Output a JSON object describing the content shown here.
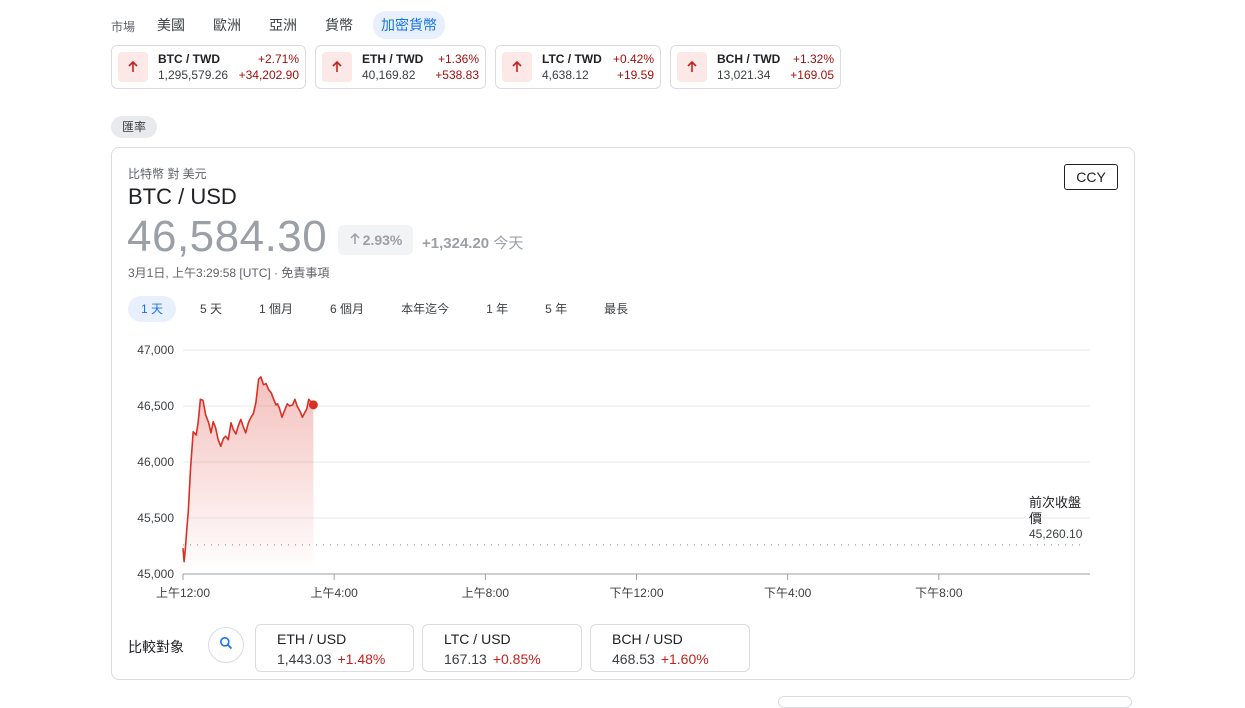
{
  "markets": {
    "label": "市場",
    "tabs": [
      {
        "label": "美國",
        "active": false
      },
      {
        "label": "歐洲",
        "active": false
      },
      {
        "label": "亞洲",
        "active": false
      },
      {
        "label": "貨幣",
        "active": false
      },
      {
        "label": "加密貨幣",
        "active": true
      }
    ]
  },
  "tickers": [
    {
      "symbol": "BTC / TWD",
      "price": "1,295,579.26",
      "pct": "+2.71%",
      "change": "+34,202.90"
    },
    {
      "symbol": "ETH / TWD",
      "price": "40,169.82",
      "pct": "+1.36%",
      "change": "+538.83"
    },
    {
      "symbol": "LTC / TWD",
      "price": "4,638.12",
      "pct": "+0.42%",
      "change": "+19.59"
    },
    {
      "symbol": "BCH / TWD",
      "price": "13,021.34",
      "pct": "+1.32%",
      "change": "+169.05"
    }
  ],
  "chip": "匯率",
  "quote": {
    "subtitle": "比特幣 對 美元",
    "pair": "BTC / USD",
    "ccy_button": "CCY",
    "price": "46,584.30",
    "pct": "2.93%",
    "change": "+1,324.20",
    "change_suffix": "今天",
    "timestamp": "3月1日, 上午3:29:58 [UTC] · 免責事項"
  },
  "ranges": [
    {
      "label": "1 天",
      "active": true
    },
    {
      "label": "5 天",
      "active": false
    },
    {
      "label": "1 個月",
      "active": false
    },
    {
      "label": "6 個月",
      "active": false
    },
    {
      "label": "本年迄今",
      "active": false
    },
    {
      "label": "1 年",
      "active": false
    },
    {
      "label": "5 年",
      "active": false
    },
    {
      "label": "最長",
      "active": false
    }
  ],
  "chart_data": {
    "type": "area",
    "title": "",
    "xlabel": "",
    "ylabel": "",
    "ylim": [
      45000,
      47000
    ],
    "y_ticks": [
      47000,
      46500,
      46000,
      45500,
      45000
    ],
    "y_tick_labels": [
      "47,000",
      "46,500",
      "46,000",
      "45,500",
      "45,000"
    ],
    "x_range_hours": [
      0,
      24
    ],
    "x_ticks": [
      0,
      4,
      8,
      12,
      16,
      20
    ],
    "x_tick_labels": [
      "上午12:00",
      "上午4:00",
      "上午8:00",
      "下午12:00",
      "下午4:00",
      "下午8:00"
    ],
    "series": [
      {
        "x": [
          0.0,
          0.03,
          0.06,
          0.1,
          0.14,
          0.2,
          0.27,
          0.3,
          0.35,
          0.4,
          0.46,
          0.53,
          0.6,
          0.68,
          0.74,
          0.8,
          0.86,
          0.93,
          1.0,
          1.07,
          1.13,
          1.2,
          1.27,
          1.33,
          1.4,
          1.46,
          1.53,
          1.6,
          1.66,
          1.73,
          1.8,
          1.86,
          1.93,
          2.0,
          2.06,
          2.13,
          2.2,
          2.26,
          2.33,
          2.4,
          2.46,
          2.5,
          2.55,
          2.62,
          2.7,
          2.76,
          2.82,
          2.9,
          2.96,
          3.02,
          3.1,
          3.16,
          3.22,
          3.27,
          3.33,
          3.4,
          3.45
        ],
        "values": [
          45230,
          45110,
          45220,
          45400,
          45560,
          45950,
          46270,
          46260,
          46240,
          46350,
          46560,
          46550,
          46420,
          46350,
          46260,
          46360,
          46310,
          46200,
          46140,
          46210,
          46230,
          46200,
          46350,
          46290,
          46250,
          46320,
          46380,
          46310,
          46260,
          46350,
          46400,
          46430,
          46530,
          46740,
          46760,
          46690,
          46700,
          46650,
          46620,
          46560,
          46510,
          46520,
          46480,
          46400,
          46470,
          46520,
          46500,
          46510,
          46560,
          46500,
          46450,
          46400,
          46440,
          46470,
          46560,
          46530,
          46520
        ]
      }
    ],
    "last_point": {
      "x": 3.45,
      "y": 46510
    },
    "reference_line": {
      "value": 45260.1,
      "label": "前次收盤價",
      "value_label": "45,260.10"
    },
    "grid": true
  },
  "compare": {
    "label": "比較對象",
    "items": [
      {
        "symbol": "ETH / USD",
        "price": "1,443.03",
        "pct": "+1.48%"
      },
      {
        "symbol": "LTC / USD",
        "price": "167.13",
        "pct": "+0.85%"
      },
      {
        "symbol": "BCH / USD",
        "price": "468.53",
        "pct": "+1.60%"
      }
    ]
  },
  "colors": {
    "accent": "#1a73e8",
    "up_red": "#d93025",
    "up_red_text": "#a50e0e",
    "up_red_bg": "#fce8e6",
    "muted": "#9aa0a6",
    "grid": "#e8eaed"
  }
}
